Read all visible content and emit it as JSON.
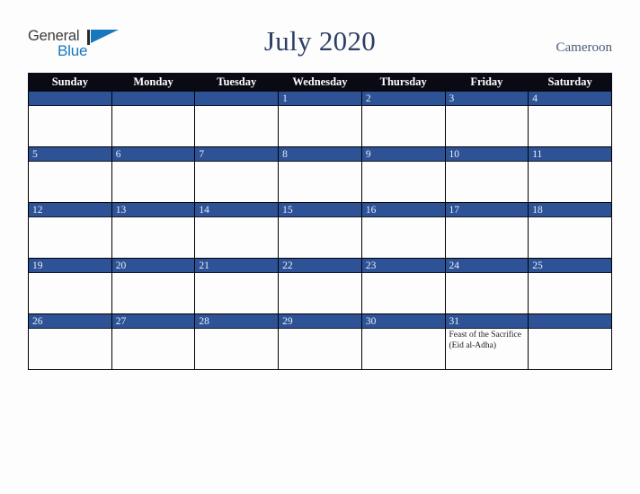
{
  "logo": {
    "word1": "General",
    "word2": "Blue",
    "mark": "triangle-icon",
    "accent_color": "#1878be"
  },
  "header": {
    "title": "July 2020",
    "country": "Cameroon",
    "title_color": "#2c3e62"
  },
  "calendar": {
    "weekday_headers": [
      "Sunday",
      "Monday",
      "Tuesday",
      "Wednesday",
      "Thursday",
      "Friday",
      "Saturday"
    ],
    "header_bg": "#0a0a14",
    "daybar_bg": "#2e5296",
    "cell_bg": "#fdfdfd",
    "weeks": [
      [
        {
          "date": "",
          "event": ""
        },
        {
          "date": "",
          "event": ""
        },
        {
          "date": "",
          "event": ""
        },
        {
          "date": "1",
          "event": ""
        },
        {
          "date": "2",
          "event": ""
        },
        {
          "date": "3",
          "event": ""
        },
        {
          "date": "4",
          "event": ""
        }
      ],
      [
        {
          "date": "5",
          "event": ""
        },
        {
          "date": "6",
          "event": ""
        },
        {
          "date": "7",
          "event": ""
        },
        {
          "date": "8",
          "event": ""
        },
        {
          "date": "9",
          "event": ""
        },
        {
          "date": "10",
          "event": ""
        },
        {
          "date": "11",
          "event": ""
        }
      ],
      [
        {
          "date": "12",
          "event": ""
        },
        {
          "date": "13",
          "event": ""
        },
        {
          "date": "14",
          "event": ""
        },
        {
          "date": "15",
          "event": ""
        },
        {
          "date": "16",
          "event": ""
        },
        {
          "date": "17",
          "event": ""
        },
        {
          "date": "18",
          "event": ""
        }
      ],
      [
        {
          "date": "19",
          "event": ""
        },
        {
          "date": "20",
          "event": ""
        },
        {
          "date": "21",
          "event": ""
        },
        {
          "date": "22",
          "event": ""
        },
        {
          "date": "23",
          "event": ""
        },
        {
          "date": "24",
          "event": ""
        },
        {
          "date": "25",
          "event": ""
        }
      ],
      [
        {
          "date": "26",
          "event": ""
        },
        {
          "date": "27",
          "event": ""
        },
        {
          "date": "28",
          "event": ""
        },
        {
          "date": "29",
          "event": ""
        },
        {
          "date": "30",
          "event": ""
        },
        {
          "date": "31",
          "event": "Feast of the Sacrifice (Eid al-Adha)"
        },
        {
          "date": "",
          "event": ""
        }
      ]
    ]
  }
}
